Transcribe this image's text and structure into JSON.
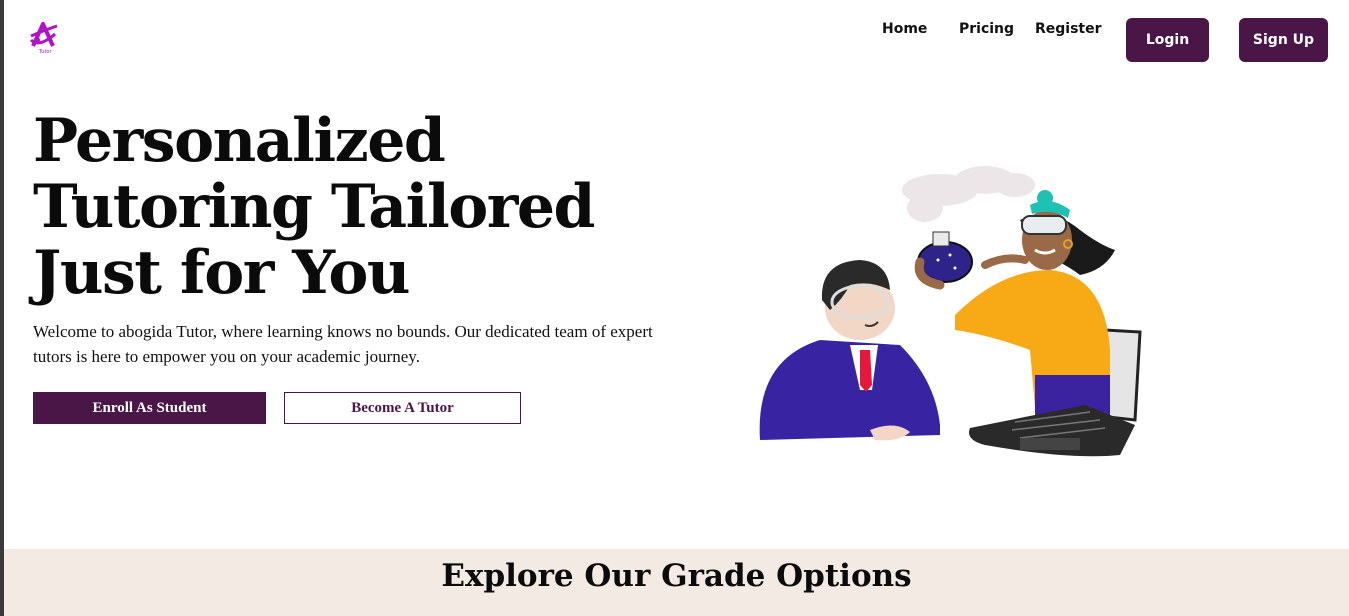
{
  "brand": {
    "logo_text": "Tutor",
    "accent_color": "#4a1547",
    "logo_color": "#b012c7"
  },
  "nav": {
    "links": [
      "Home",
      "Pricing",
      "Register"
    ],
    "login_label": "Login",
    "signup_label": "Sign Up"
  },
  "hero": {
    "title_lines": [
      "Personalized",
      "Tutoring Tailored",
      "Just for You"
    ],
    "description": "Welcome to abogida Tutor, where learning knows no bounds. Our dedicated team of expert tutors is here to empower you on your academic journey.",
    "enroll_label": "Enroll As Student",
    "tutor_label": "Become A Tutor",
    "illustration": "tutoring-illustration"
  },
  "grades": {
    "title": "Explore Our Grade Options",
    "background_color": "#f3ebe3"
  }
}
